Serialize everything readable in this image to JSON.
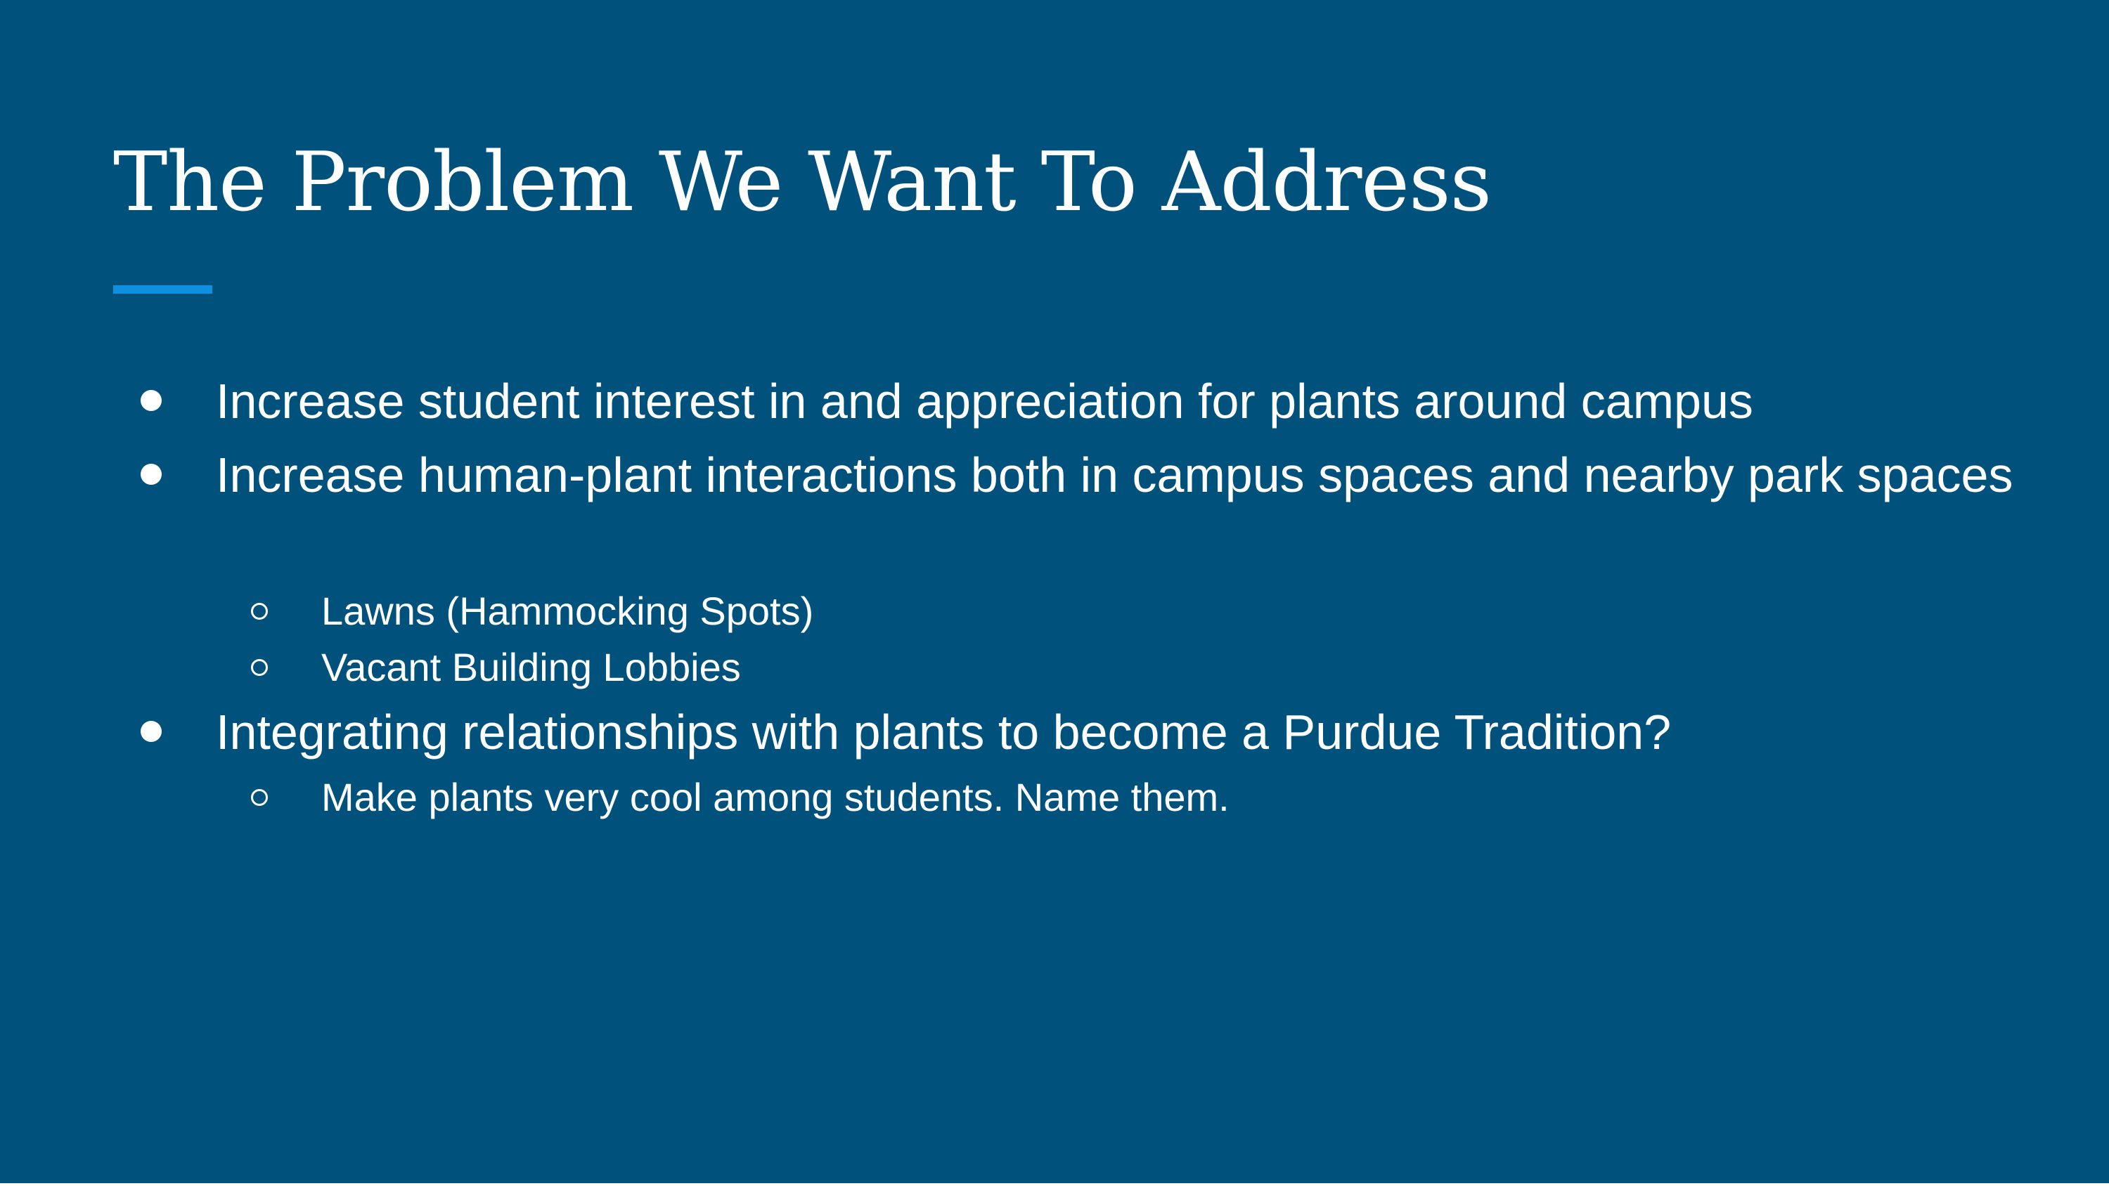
{
  "slide": {
    "title": "The Problem We Want To Address",
    "accent_color": "#0e90e0",
    "background_color": "#00527c",
    "bullets": [
      {
        "text": "Increase student interest in and appreciation for plants around campus",
        "level": 1
      },
      {
        "text": "Increase human-plant interactions both in campus spaces and nearby park spaces",
        "level": 1,
        "subitems": [
          "Lawns (Hammocking Spots)",
          "Vacant Building Lobbies"
        ]
      },
      {
        "text": "Integrating relationships with plants to become a Purdue Tradition?",
        "level": 1,
        "subitems": [
          "Make plants very cool among students. Name them."
        ]
      }
    ]
  }
}
